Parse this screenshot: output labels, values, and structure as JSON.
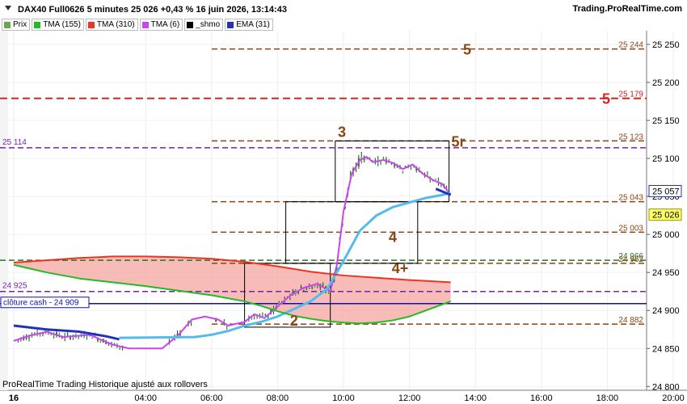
{
  "header": {
    "title": "DAX40 Full0626 5 minutes 25 026 +0,43 % 16 juin 2026, 13:14:43",
    "watermark": "Trading.ProRealTime.com"
  },
  "legend": [
    {
      "label": "Prix",
      "color": "#6aa84f"
    },
    {
      "label": "TMA (155)",
      "color": "#22bb22"
    },
    {
      "label": "TMA (310)",
      "color": "#ee3322"
    },
    {
      "label": "TMA (6)",
      "color": "#cc44ee"
    },
    {
      "label": "_shmo",
      "color": "#000000"
    },
    {
      "label": "EMA (31)",
      "color": "#2233bb"
    }
  ],
  "footer": "ProRealTime Trading  Historique ajusté aux rollovers",
  "chart_data": {
    "type": "line",
    "x_ticks": [
      "16",
      "04:00",
      "06:00",
      "08:00",
      "10:00",
      "12:00",
      "14:00",
      "16:00",
      "18:00",
      "20:00"
    ],
    "y_ticks": [
      "25 250",
      "25 200",
      "25 150",
      "25 100",
      "25 050",
      "25 000",
      "24 950",
      "24 900",
      "24 850",
      "24 800"
    ],
    "ylim": [
      24795,
      25268
    ],
    "y_tick_values": [
      25250,
      25200,
      25150,
      25100,
      25050,
      25000,
      24950,
      24900,
      24850,
      24800
    ],
    "x_tick_hours": [
      0,
      4,
      6,
      8,
      10,
      12,
      14,
      16,
      18,
      20
    ],
    "levels": [
      {
        "value": 25244,
        "label": "25 244",
        "style": "brown-dash",
        "tag": "5"
      },
      {
        "value": 25179,
        "label": "25 179",
        "style": "red-dash",
        "tag": "5"
      },
      {
        "value": 25123,
        "label": "25 123",
        "style": "brown-dash",
        "tag": "5r"
      },
      {
        "value": 25114,
        "label": "25 114",
        "style": "purple-dash",
        "tag": ""
      },
      {
        "value": 25043,
        "label": "25 043",
        "style": "brown-dash",
        "tag": ""
      },
      {
        "value": 25003,
        "label": "25 003",
        "style": "brown-dash",
        "tag": "4"
      },
      {
        "value": 24966,
        "label": "24 966",
        "style": "green-dash",
        "tag": ""
      },
      {
        "value": 24962,
        "label": "24 962",
        "style": "brown-dash",
        "tag": "4+"
      },
      {
        "value": 24925,
        "label": "24 925",
        "style": "purple-dash",
        "tag": ""
      },
      {
        "value": 24909,
        "label": "24 909",
        "style": "blue-solid",
        "tag": ""
      },
      {
        "value": 24882,
        "label": "24 882",
        "style": "brown-dash",
        "tag": ""
      }
    ],
    "left_labels": {
      "level_25114": "25 114",
      "level_24925": "24 925",
      "cloture": "clôture cash -  24 909"
    },
    "price_tags": [
      {
        "value": 25057,
        "label": "25 057",
        "fill": "#ffffff",
        "border": "#2233bb"
      },
      {
        "value": 25026,
        "label": "25 026",
        "fill": "#ffff66",
        "border": "#999900"
      }
    ],
    "wave_labels": [
      {
        "text": "3",
        "hour": 9.95,
        "value": 25128
      },
      {
        "text": "2",
        "hour": 8.5,
        "value": 24880
      }
    ],
    "boxes": [
      {
        "t0": 9.75,
        "t1": 13.2,
        "v0": 25043,
        "v1": 25123
      },
      {
        "t0": 8.25,
        "t1": 12.25,
        "v0": 24962,
        "v1": 25043
      },
      {
        "t0": 7.0,
        "t1": 9.6,
        "v0": 24878,
        "v1": 24962
      }
    ],
    "series": [
      {
        "name": "TMA (6)",
        "color": "#cc44ee",
        "x": [
          0,
          0.5,
          1,
          1.5,
          2.3,
          3,
          3.5,
          4.5,
          5,
          5.4,
          5.8,
          6.2,
          6.5,
          7,
          7.3,
          7.6,
          8,
          8.4,
          8.8,
          9.2,
          9.6,
          9.8,
          10.0,
          10.25,
          10.5,
          10.7,
          10.9,
          11.2,
          11.5,
          11.8,
          12.1,
          12.4,
          12.7,
          13.0,
          13.25
        ],
        "y": [
          24860,
          24867,
          24872,
          24865,
          24868,
          24855,
          24850,
          24850,
          24868,
          24888,
          24892,
          24888,
          24880,
          24885,
          24895,
          24890,
          24905,
          24920,
          24930,
          24935,
          24925,
          24960,
          25030,
          25080,
          25098,
          25102,
          25095,
          25098,
          25094,
          25086,
          25092,
          25080,
          25072,
          25066,
          25052
        ]
      },
      {
        "name": "EMA (31)",
        "color": "#2233bb",
        "x": [
          0,
          1,
          2,
          2.8,
          3.2
        ],
        "y": [
          24880,
          24875,
          24872,
          24866,
          24862
        ]
      },
      {
        "name": "_shmo",
        "color": "#55bbee",
        "x": [
          3.2,
          5.5,
          6.0,
          6.5,
          7.0,
          7.5,
          8.0,
          8.5,
          9.0,
          9.5,
          10.0,
          10.5,
          11.0,
          11.5,
          12.0,
          12.5,
          13.0,
          13.25
        ],
        "y": [
          24864,
          24865,
          24868,
          24873,
          24880,
          24885,
          24892,
          24902,
          24912,
          24928,
          24965,
          25005,
          25025,
          25036,
          25042,
          25048,
          25052,
          25055
        ]
      },
      {
        "name": "TMA (310)",
        "color": "#ee3322",
        "x": [
          0,
          1,
          2,
          3,
          4,
          5,
          6,
          7,
          8,
          9,
          10,
          11,
          12,
          13.25
        ],
        "y": [
          24963,
          24966,
          24969,
          24971,
          24971,
          24970,
          24968,
          24964,
          24958,
          24951,
          24946,
          24943,
          24940,
          24937
        ]
      },
      {
        "name": "TMA (155)",
        "color": "#22bb22",
        "x": [
          0,
          0.5,
          1,
          2,
          3,
          4,
          5,
          6,
          7,
          7.5,
          8,
          8.5,
          9,
          9.5,
          10,
          10.5,
          11,
          11.5,
          12,
          12.5,
          13.25
        ],
        "y": [
          24960,
          24955,
          24950,
          24942,
          24937,
          24932,
          24926,
          24920,
          24912,
          24906,
          24899,
          24893,
          24889,
          24886,
          24884,
          24883,
          24884,
          24887,
          24892,
          24900,
          24912
        ]
      }
    ]
  }
}
